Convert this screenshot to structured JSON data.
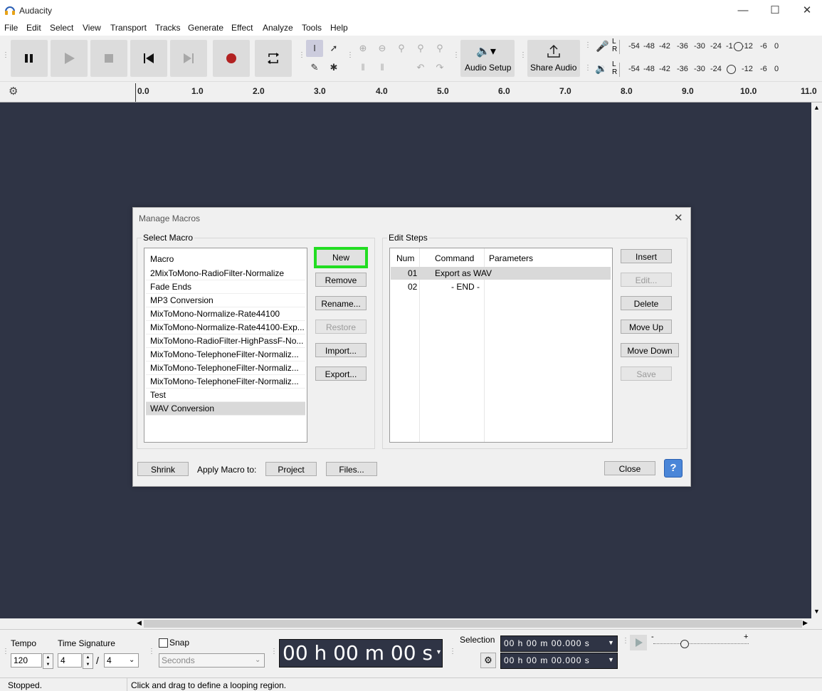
{
  "window": {
    "title": "Audacity"
  },
  "menu": [
    "File",
    "Edit",
    "Select",
    "View",
    "Transport",
    "Tracks",
    "Generate",
    "Effect",
    "Analyze",
    "Tools",
    "Help"
  ],
  "toolbar": {
    "audio_setup": "Audio Setup",
    "share_audio": "Share Audio",
    "meter_scale": [
      "-54",
      "-48",
      "-42",
      "-36",
      "-30",
      "-24",
      "-18",
      "-12",
      "-6",
      "0"
    ],
    "meter_rec_scale": [
      "-54",
      "-48",
      "-42",
      "-36",
      "-30",
      "-24",
      "-1",
      "-12",
      "-6",
      "0"
    ],
    "meter_channels": [
      "L",
      "R"
    ]
  },
  "ruler": {
    "ticks": [
      "0.0",
      "1.0",
      "2.0",
      "3.0",
      "4.0",
      "5.0",
      "6.0",
      "7.0",
      "8.0",
      "9.0",
      "10.0",
      "11.0"
    ]
  },
  "dialog": {
    "title": "Manage Macros",
    "select_macro_label": "Select Macro",
    "macro_header": "Macro",
    "macros": [
      "2MixToMono-RadioFilter-Normalize",
      "Fade Ends",
      "MP3 Conversion",
      "MixToMono-Normalize-Rate44100",
      "MixToMono-Normalize-Rate44100-Exp...",
      "MixToMono-RadioFilter-HighPassF-No...",
      "MixToMono-TelephoneFilter-Normaliz...",
      "MixToMono-TelephoneFilter-Normaliz...",
      "MixToMono-TelephoneFilter-Normaliz...",
      "Test",
      "WAV Conversion"
    ],
    "macro_buttons": [
      "New",
      "Remove",
      "Rename...",
      "Restore",
      "Import...",
      "Export..."
    ],
    "edit_steps_label": "Edit Steps",
    "steps_headers": [
      "Num",
      "Command",
      "Parameters"
    ],
    "steps": [
      {
        "num": "01",
        "command": "Export as WAV",
        "params": ""
      },
      {
        "num": "02",
        "command": "- END -",
        "params": ""
      }
    ],
    "step_buttons": [
      "Insert",
      "Edit...",
      "Delete",
      "Move Up",
      "Move Down",
      "Save"
    ],
    "shrink": "Shrink",
    "apply_macro_to": "Apply Macro to:",
    "project": "Project",
    "files": "Files...",
    "close": "Close",
    "help": "?"
  },
  "bottom": {
    "tempo_label": "Tempo",
    "tempo_value": "120",
    "time_sig_label": "Time Signature",
    "time_sig_num": "4",
    "time_sig_slash": "/",
    "time_sig_den": "4",
    "snap_label": "Snap",
    "snap_unit": "Seconds",
    "time_display": "00 h 00 m 00 s",
    "selection_label": "Selection",
    "sel_start": "00 h 00 m 00.000 s",
    "sel_end": "00 h 00 m 00.000 s",
    "speed_min": "-",
    "speed_max": "+"
  },
  "status": {
    "left": "Stopped.",
    "right": "Click and drag to define a looping region."
  }
}
